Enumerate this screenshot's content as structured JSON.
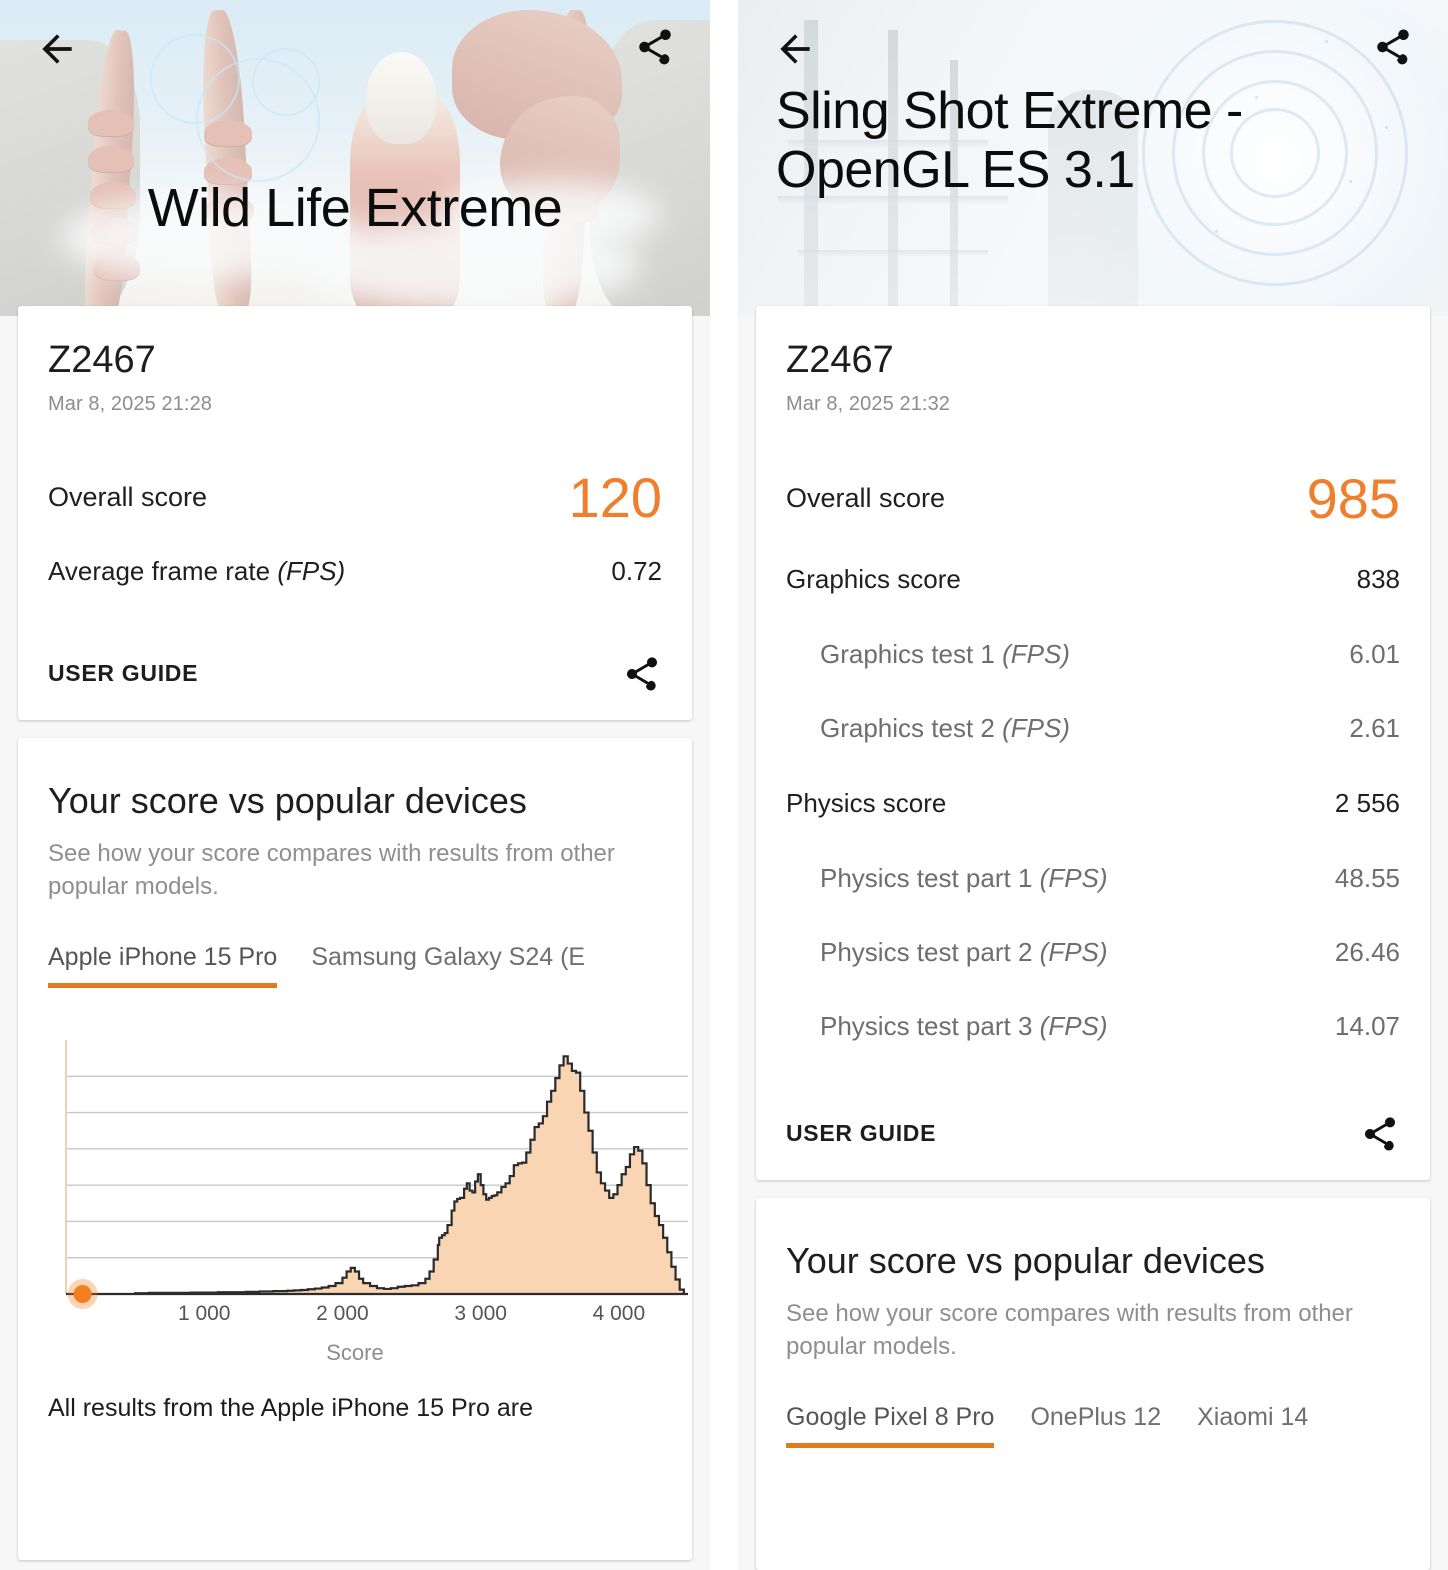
{
  "accent_color": "#ef7f2c",
  "left": {
    "header": {
      "back_icon": "back-arrow-icon",
      "share_icon": "share-icon",
      "title": "Wild Life Extreme"
    },
    "result": {
      "device_name": "Z2467",
      "date": "Mar 8, 2025 21:28",
      "rows": [
        {
          "label": "Overall score",
          "value": "120",
          "type": "overall"
        },
        {
          "label": "Average frame rate ",
          "label_italic": "(FPS)",
          "value": "0.72",
          "type": "fps"
        }
      ],
      "user_guide_label": "USER GUIDE",
      "share_icon": "share-icon"
    },
    "compare": {
      "title": "Your score vs popular devices",
      "subtitle": "See how your score compares with results from other popular models.",
      "tabs": [
        {
          "label": "Apple iPhone 15 Pro",
          "active": true
        },
        {
          "label": "Samsung Galaxy S24 (E",
          "active": false
        }
      ],
      "note": "All results from the Apple iPhone 15 Pro are"
    }
  },
  "right": {
    "header": {
      "back_icon": "back-arrow-icon",
      "share_icon": "share-icon",
      "title": "Sling Shot Extreme - OpenGL ES 3.1"
    },
    "result": {
      "device_name": "Z2467",
      "date": "Mar 8, 2025 21:32",
      "rows": [
        {
          "label": "Overall score",
          "value": "985",
          "type": "overall"
        },
        {
          "label": "Graphics score",
          "value": "838",
          "type": "main"
        },
        {
          "label": "Graphics test 1 ",
          "label_italic": "(FPS)",
          "value": "6.01",
          "type": "sub"
        },
        {
          "label": "Graphics test 2 ",
          "label_italic": "(FPS)",
          "value": "2.61",
          "type": "sub"
        },
        {
          "label": "Physics score",
          "value": "2 556",
          "type": "main"
        },
        {
          "label": "Physics test part 1 ",
          "label_italic": "(FPS)",
          "value": "48.55",
          "type": "sub"
        },
        {
          "label": "Physics test part 2 ",
          "label_italic": "(FPS)",
          "value": "26.46",
          "type": "sub"
        },
        {
          "label": "Physics test part 3 ",
          "label_italic": "(FPS)",
          "value": "14.07",
          "type": "sub"
        }
      ],
      "user_guide_label": "USER GUIDE",
      "share_icon": "share-icon"
    },
    "compare": {
      "title": "Your score vs popular devices",
      "subtitle": "See how your score compares with results from other popular models.",
      "tabs": [
        {
          "label": "Google Pixel 8 Pro",
          "active": true
        },
        {
          "label": "OnePlus 12",
          "active": false
        },
        {
          "label": "Xiaomi 14",
          "active": false
        }
      ]
    }
  },
  "chart_data": {
    "type": "area",
    "title": "",
    "xlabel": "Score",
    "ylabel": "",
    "xlim": [
      0,
      4500
    ],
    "ylim": [
      0,
      7
    ],
    "grid": true,
    "legend": false,
    "gridlines_y": [
      1,
      2,
      3,
      4,
      5,
      6
    ],
    "xticks": [
      1000,
      2000,
      3000,
      4000
    ],
    "xtick_labels": [
      "1 000",
      "2 000",
      "3 000",
      "4 000"
    ],
    "series_name": "Apple iPhone 15 Pro score distribution",
    "marker": {
      "label": "Your score",
      "x": 120,
      "y": 0,
      "color": "#f47f20"
    },
    "fill_color": "#fad5b4",
    "line_color": "#2b2b2b",
    "x": [
      0,
      100,
      200,
      300,
      400,
      500,
      600,
      700,
      800,
      900,
      1000,
      1100,
      1200,
      1300,
      1400,
      1500,
      1600,
      1650,
      1700,
      1750,
      1800,
      1850,
      1900,
      1950,
      2000,
      2030,
      2060,
      2090,
      2120,
      2150,
      2200,
      2250,
      2300,
      2350,
      2400,
      2450,
      2500,
      2550,
      2600,
      2630,
      2660,
      2690,
      2700,
      2720,
      2740,
      2760,
      2790,
      2810,
      2830,
      2850,
      2880,
      2900,
      2920,
      2940,
      2960,
      2980,
      3000,
      3020,
      3040,
      3060,
      3080,
      3100,
      3120,
      3150,
      3180,
      3210,
      3240,
      3270,
      3300,
      3330,
      3360,
      3390,
      3420,
      3450,
      3480,
      3510,
      3540,
      3570,
      3600,
      3630,
      3660,
      3690,
      3720,
      3750,
      3780,
      3810,
      3840,
      3870,
      3900,
      3930,
      3960,
      3990,
      4020,
      4050,
      4080,
      4110,
      4140,
      4170,
      4200,
      4230,
      4260,
      4290,
      4320,
      4350,
      4380,
      4410,
      4440,
      4470,
      4500
    ],
    "y": [
      0,
      0,
      0,
      0,
      0,
      0.02,
      0.03,
      0.03,
      0.03,
      0.04,
      0.04,
      0.05,
      0.05,
      0.06,
      0.07,
      0.08,
      0.09,
      0.1,
      0.11,
      0.13,
      0.15,
      0.18,
      0.22,
      0.3,
      0.45,
      0.62,
      0.72,
      0.62,
      0.42,
      0.3,
      0.22,
      0.16,
      0.14,
      0.16,
      0.2,
      0.22,
      0.24,
      0.3,
      0.42,
      0.62,
      0.95,
      1.35,
      1.55,
      1.62,
      1.68,
      1.9,
      2.3,
      2.55,
      2.62,
      2.65,
      2.9,
      3.05,
      2.85,
      2.8,
      3.1,
      3.3,
      3.0,
      2.75,
      2.6,
      2.65,
      2.7,
      2.72,
      2.8,
      2.95,
      3.05,
      3.25,
      3.55,
      3.6,
      3.62,
      3.9,
      4.25,
      4.6,
      4.7,
      4.9,
      5.3,
      5.6,
      5.95,
      6.3,
      6.55,
      6.35,
      6.15,
      6.1,
      5.6,
      5.0,
      4.5,
      3.9,
      3.35,
      3.05,
      2.85,
      2.65,
      2.75,
      3.0,
      3.3,
      3.5,
      3.85,
      4.05,
      3.95,
      3.6,
      3.0,
      2.5,
      2.15,
      1.9,
      1.55,
      1.15,
      0.75,
      0.4,
      0.12,
      0.0,
      0.0,
      0.0
    ]
  }
}
